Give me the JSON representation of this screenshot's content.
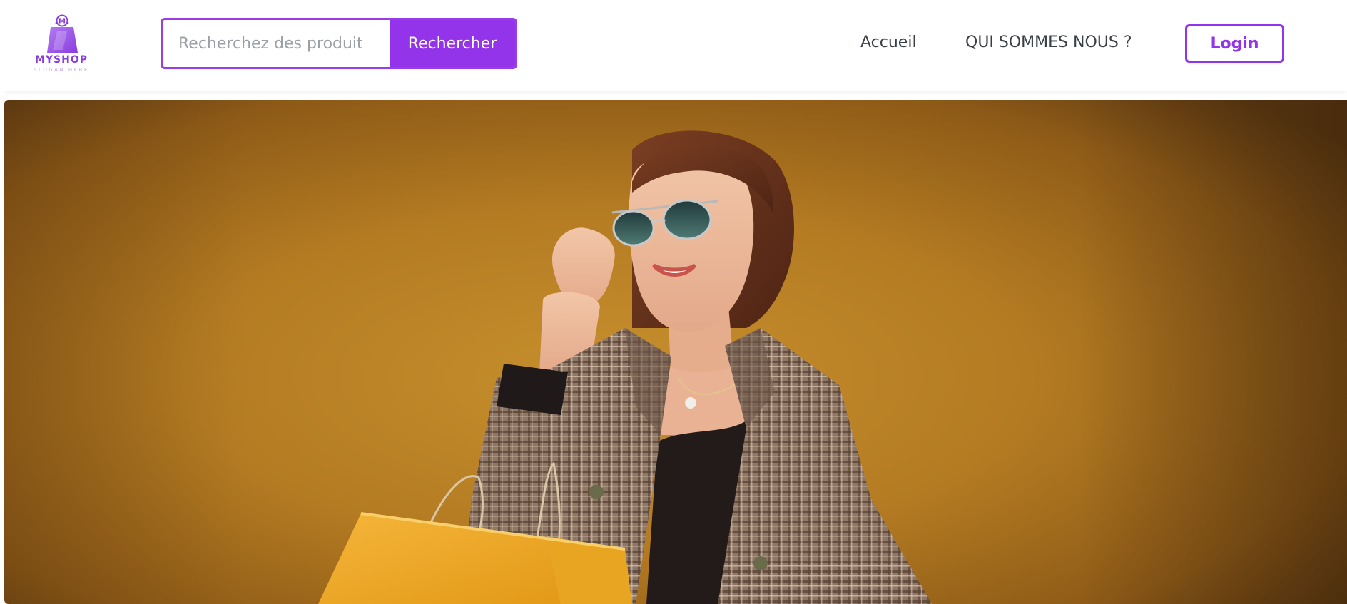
{
  "brand": {
    "name": "MYSHOP",
    "slogan": "SLOGAN HERE",
    "logo_icon": "shopping-bag-icon",
    "logo_letter": "M",
    "accent_color": "#9333ea"
  },
  "search": {
    "placeholder": "Recherchez des produit",
    "value": "",
    "button_label": "Rechercher"
  },
  "nav": {
    "items": [
      {
        "label": "Accueil"
      },
      {
        "label": "QUI SOMMES NOUS ?"
      }
    ],
    "login_label": "Login"
  },
  "hero": {
    "image": "woman-with-sunglasses-and-shopping-bags",
    "background_color": "#b47b22"
  }
}
